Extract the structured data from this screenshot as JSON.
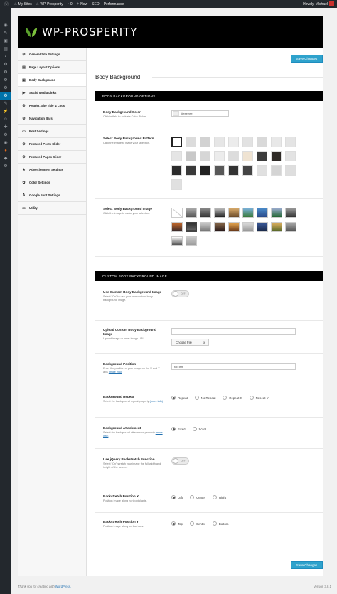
{
  "adminbar": {
    "my_sites": "My Sites",
    "site_name": "WP-Prosperity",
    "comments_count": "0",
    "new_label": "New",
    "seo_label": "SEO",
    "performance_label": "Performance",
    "howdy": "Howdy, Michael"
  },
  "header": {
    "logo_text": "WP-PROSPERITY"
  },
  "sidebar": {
    "items": [
      {
        "label": "General Site Settings",
        "icon": "gear-icon"
      },
      {
        "label": "Page Layout Options",
        "icon": "layout-icon"
      },
      {
        "label": "Body Background",
        "icon": "image-icon"
      },
      {
        "label": "Social Media Links",
        "icon": "share-icon"
      },
      {
        "label": "Header, Site Title & Logo",
        "icon": "gear-icon"
      },
      {
        "label": "Navigation Bars",
        "icon": "gear-icon"
      },
      {
        "label": "Post Settings",
        "icon": "document-icon"
      },
      {
        "label": "Featured Posts Slider",
        "icon": "gear-icon"
      },
      {
        "label": "Featured Pages Slider",
        "icon": "gear-icon"
      },
      {
        "label": "Advertisement Settings",
        "icon": "star-icon"
      },
      {
        "label": "Color Settings",
        "icon": "color-icon"
      },
      {
        "label": "Google Font Settings",
        "icon": "font-icon"
      },
      {
        "label": "Utility",
        "icon": "document-icon"
      }
    ]
  },
  "main": {
    "save_label": "Save Changes",
    "page_title": "Body Background",
    "section1": "BODY BACKGROUND OPTIONS",
    "section2": "CUSTOM BODY BACKGROUND IMAGE",
    "color": {
      "label": "Body Background Color",
      "desc": "Click in field to activate Color Picker.",
      "value": "#eeeeee"
    },
    "pattern": {
      "label": "Select Body Background Pattern",
      "desc": "Click the image to make your selection."
    },
    "image": {
      "label": "Select Body Background Image",
      "desc": "Click the image to make your selection."
    },
    "use_custom": {
      "label": "Use Custom Body Background Image",
      "desc": "Select \"On\" to use your own custom body background image.",
      "toggle": "OFF"
    },
    "upload": {
      "label": "Upload Custom Body Background Image",
      "desc": "Upload image or enter image URL.",
      "choose": "Choose File",
      "x": "x"
    },
    "position": {
      "label": "Background Position",
      "desc": "Enter the position of your image on the X and Y axis",
      "more": "(more info)",
      "value": "top left"
    },
    "repeat": {
      "label": "Background Repeat",
      "desc": "Select the background repeat property",
      "more": "(more info)",
      "options": [
        "Repeat",
        "No Repeat",
        "Repeat-X",
        "Repeat-Y"
      ]
    },
    "attachment": {
      "label": "Background Attachment",
      "desc": "Select the background attachment property",
      "more": "(more info)",
      "options": [
        "Fixed",
        "Scroll"
      ]
    },
    "backstretch": {
      "label": "Use jQuery Backstretch Function",
      "desc": "Select \"On\" stretch your image the full width and height of the screen.",
      "toggle": "OFF"
    },
    "pos_x": {
      "label": "Backstretch Position X",
      "desc": "Position image along horizontal axis.",
      "options": [
        "Left",
        "Center",
        "Right"
      ]
    },
    "pos_y": {
      "label": "Backstretch Position Y",
      "desc": "Position image along vertical axis.",
      "options": [
        "Top",
        "Center",
        "Bottom"
      ]
    }
  },
  "footer": {
    "thanks": "Thank you for creating with",
    "wp": "WordPress.",
    "version": "Version 3.8.1"
  },
  "colors": {
    "accent": "#2ea2cc",
    "adminbar": "#23282d",
    "active_menu": "#0073aa"
  }
}
